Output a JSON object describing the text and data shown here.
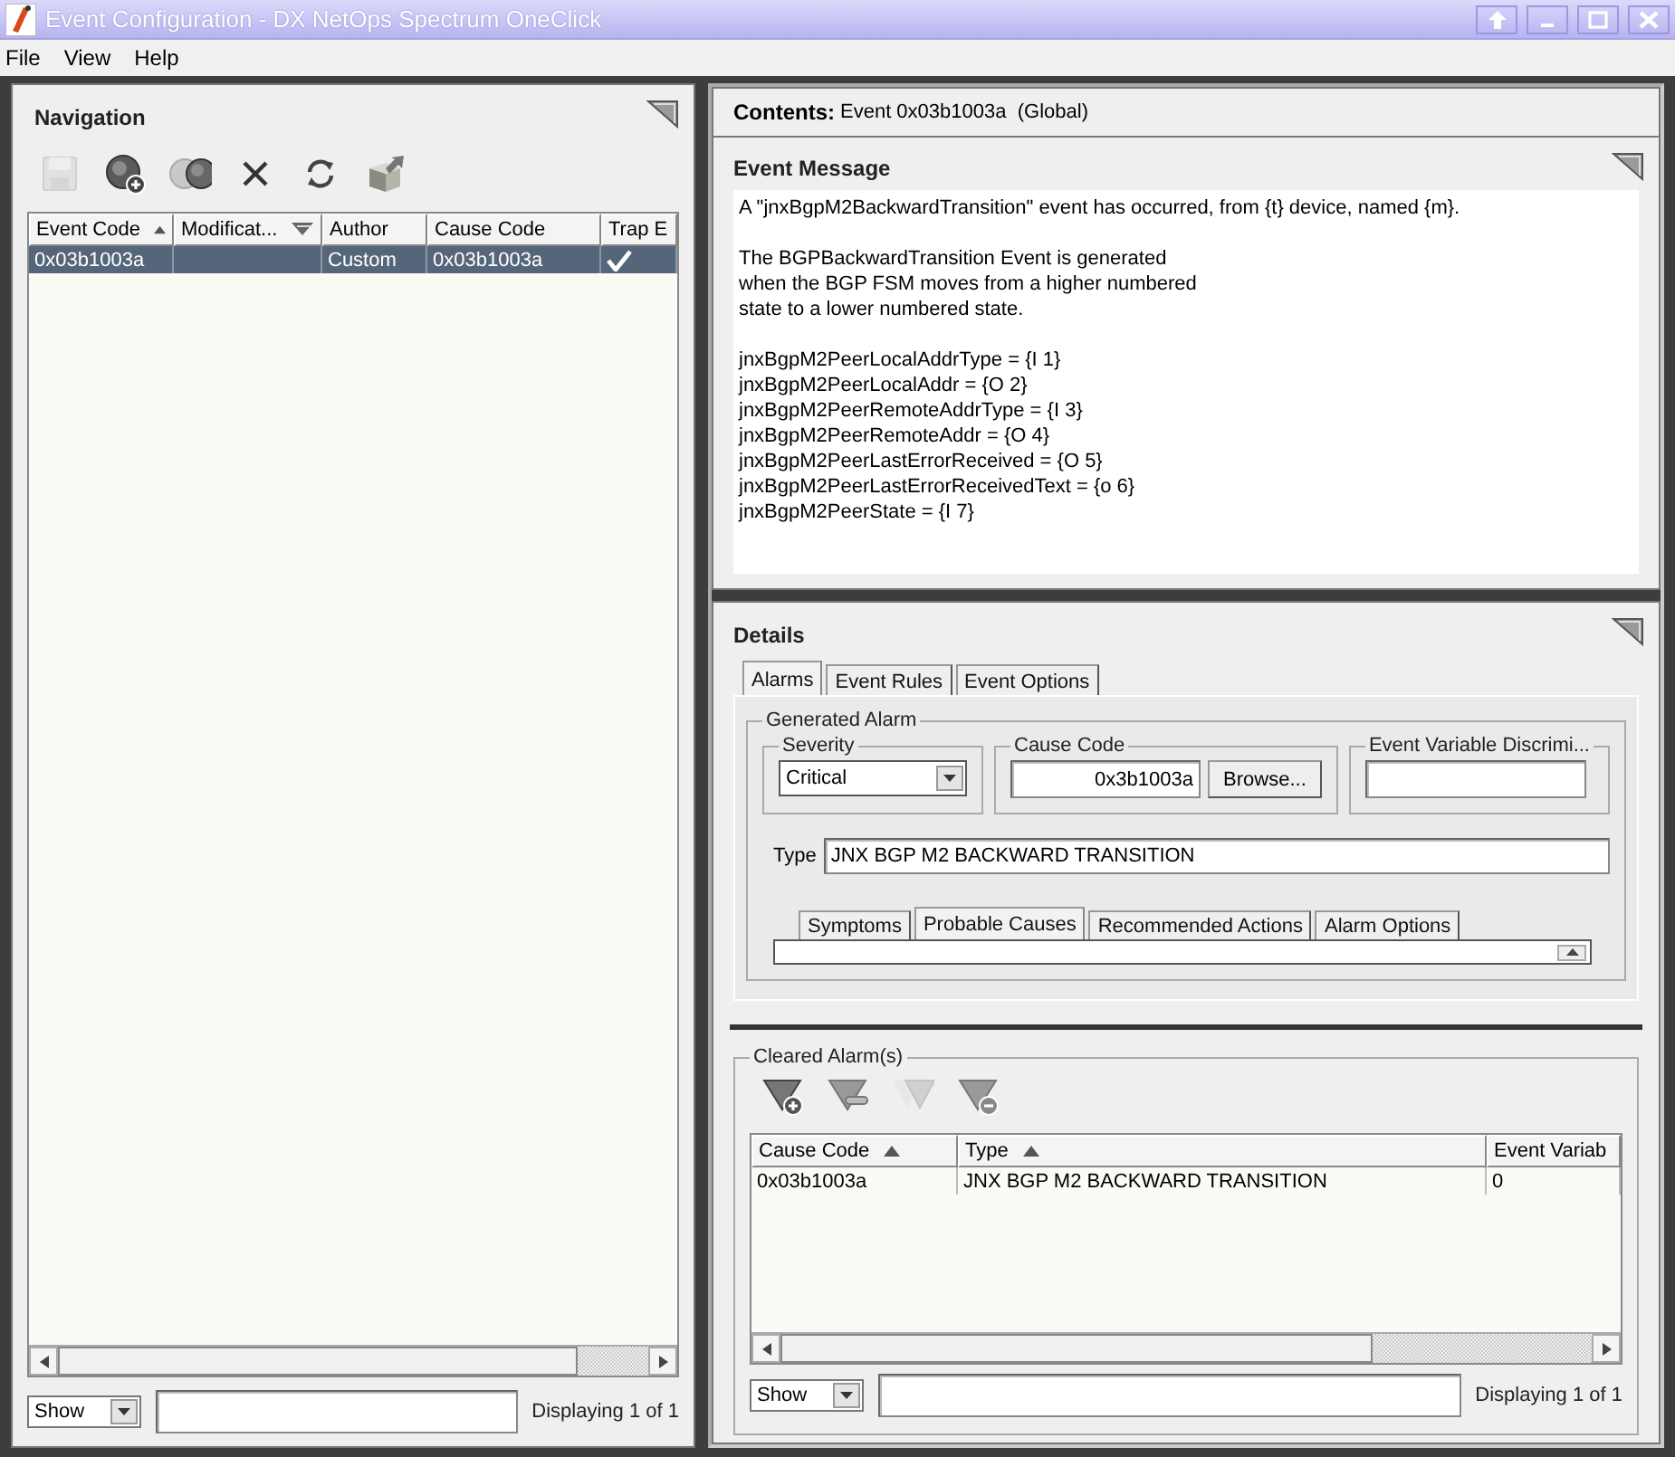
{
  "window": {
    "title": "Event Configuration - DX NetOps Spectrum OneClick"
  },
  "menu": [
    "File",
    "View",
    "Help"
  ],
  "navigation": {
    "title": "Navigation",
    "toolbar": [
      {
        "kind": "save",
        "disabled": true
      },
      {
        "kind": "add",
        "disabled": false
      },
      {
        "kind": "copy",
        "disabled": false
      },
      {
        "kind": "delete",
        "disabled": false
      },
      {
        "kind": "refresh",
        "disabled": false
      },
      {
        "kind": "export",
        "disabled": false
      }
    ],
    "table": {
      "columns": [
        {
          "label": "Event Code",
          "kind": "ascending"
        },
        {
          "label": "Modificat...",
          "kind": "descending"
        },
        {
          "label": "Author",
          "kind": "plain"
        },
        {
          "label": "Cause Code",
          "kind": "plain"
        },
        {
          "label": "Trap E",
          "kind": "plain"
        }
      ],
      "rows": [
        {
          "selected": true,
          "event_code": "0x03b1003a",
          "author": "Custom",
          "cause_code": "0x03b1003a",
          "trap_enabled": true
        }
      ]
    },
    "footer": {
      "dropdown": "Show",
      "status": "Displaying 1 of 1"
    }
  },
  "contents": {
    "label": "Contents:",
    "value": "Event 0x03b1003a  (Global)"
  },
  "event_message": {
    "title": "Event Message",
    "paragraphs": [
      "A \"jnxBgpM2BackwardTransition\" event has occurred, from {t} device, named {m}.",
      "The BGPBackwardTransition Event is generated\nwhen the BGP FSM moves from a higher numbered\nstate to a lower numbered state.",
      "jnxBgpM2PeerLocalAddrType = {I 1}\njnxBgpM2PeerLocalAddr = {O 2}\njnxBgpM2PeerRemoteAddrType = {I 3}\njnxBgpM2PeerRemoteAddr = {O 4}\njnxBgpM2PeerLastErrorReceived = {O 5}\njnxBgpM2PeerLastErrorReceivedText = {o 6}\njnxBgpM2PeerState = {I 7}"
    ]
  },
  "details": {
    "title": "Details",
    "tabs": [
      {
        "label": "Alarms",
        "selected": true
      },
      {
        "label": "Event Rules",
        "selected": false
      },
      {
        "label": "Event Options",
        "selected": false
      }
    ],
    "generated_alarm": {
      "legend": "Generated Alarm",
      "severity": {
        "legend": "Severity",
        "value": "Critical"
      },
      "cause_code": {
        "legend": "Cause Code",
        "value": "0x3b1003a",
        "button": "Browse..."
      },
      "discriminator": {
        "legend": "Event Variable Discrimi..."
      },
      "type": {
        "label": "Type",
        "value": "JNX BGP M2 BACKWARD TRANSITION"
      },
      "tabs": [
        {
          "label": "Symptoms",
          "selected": false
        },
        {
          "label": "Probable Causes",
          "selected": true
        },
        {
          "label": "Recommended Actions",
          "selected": false
        },
        {
          "label": "Alarm Options",
          "selected": false
        }
      ]
    },
    "cleared_alarms": {
      "legend": "Cleared Alarm(s)",
      "toolbar": [
        {
          "kind": "filter-add",
          "disabled": false
        },
        {
          "kind": "filter-edit",
          "disabled": false
        },
        {
          "kind": "filter-copy",
          "disabled": true
        },
        {
          "kind": "filter-remove",
          "disabled": false
        }
      ],
      "table": {
        "columns": [
          {
            "label": "Cause Code",
            "kind": "ascending"
          },
          {
            "label": "Type",
            "kind": "ascending"
          },
          {
            "label": "Event Variab",
            "kind": "plain"
          }
        ],
        "rows": [
          {
            "selected": false,
            "cause_code": "0x03b1003a",
            "type": "JNX BGP M2 BACKWARD TRANSITION",
            "event_variable": "0"
          }
        ]
      },
      "footer": {
        "dropdown": "Show",
        "status": "Displaying 1 of 1"
      }
    }
  }
}
